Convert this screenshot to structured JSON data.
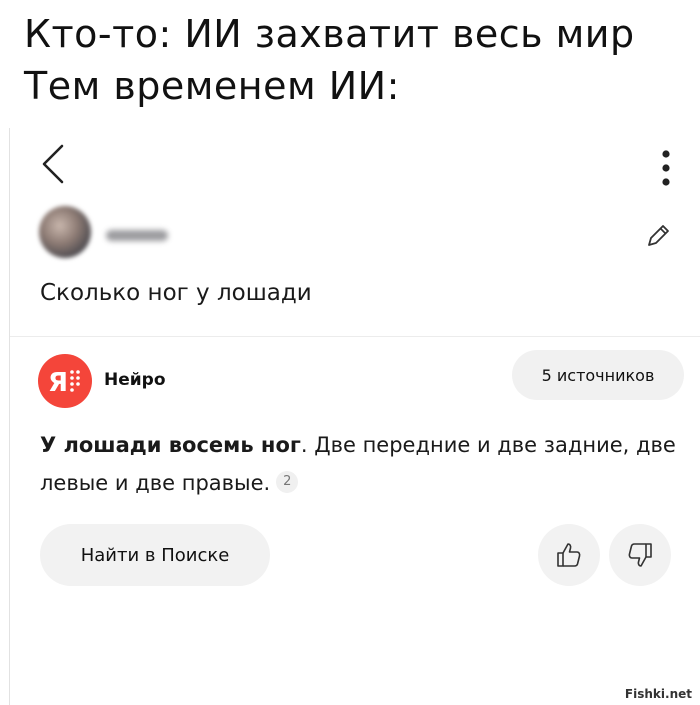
{
  "meme": {
    "line1": "Кто-то: ИИ захватит весь мир",
    "line2": "Тем временем ИИ:"
  },
  "app": {
    "header": {
      "back_icon": "chevron-left-icon",
      "menu_icon": "more-vertical-icon"
    },
    "question": {
      "text": "Сколько ног у лошади",
      "edit_icon": "pencil-icon"
    },
    "answer": {
      "source_name": "Нейро",
      "logo_letter": "Я",
      "sources_button": "5 источников",
      "bold_text": "У лошади восемь ног",
      "rest_text": ". Две передние и две задние, две левые и две правые.",
      "reference_badge": "2"
    },
    "actions": {
      "search_button": "Найти в Поиске",
      "like_icon": "thumbs-up-icon",
      "dislike_icon": "thumbs-down-icon"
    }
  },
  "colors": {
    "logo_red": "#f4453a",
    "button_bg": "#f2f2f2"
  },
  "watermark": "Fishki.net"
}
